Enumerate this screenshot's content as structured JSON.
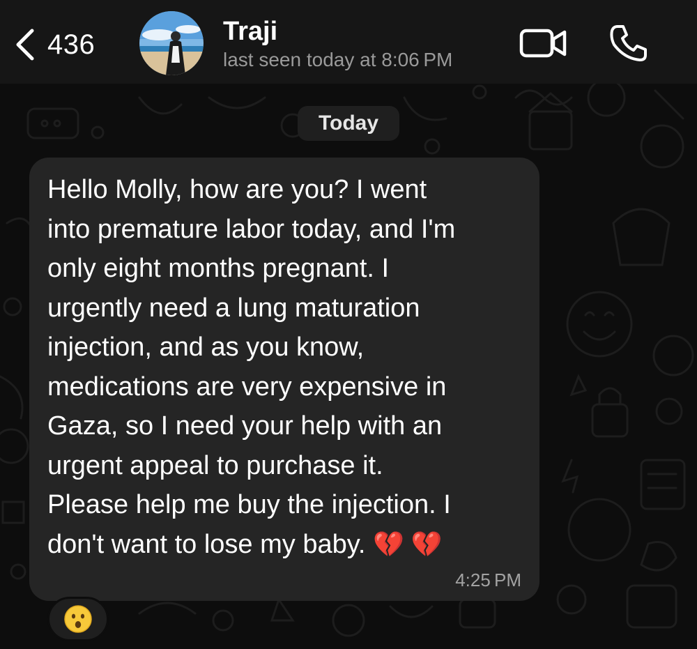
{
  "header": {
    "back_count": "436",
    "contact_name": "Traji",
    "last_seen": "last seen today at 8:06 PM"
  },
  "chat": {
    "date_label": "Today",
    "message": {
      "lines": [
        "Hello Molly, how are you? I went",
        "into premature labor today, and I'm",
        "only eight months pregnant. I",
        "urgently need a lung maturation",
        "injection, and as you know,",
        "medications are very expensive in",
        "Gaza, so I need your help with an",
        "urgent appeal to purchase it.",
        "Please help me buy the injection. I",
        "don't want to lose my baby. "
      ],
      "emoji": "💔 💔",
      "time": "4:25 PM"
    },
    "reaction": {
      "icon": "surprised-face-icon",
      "emoji": "😮"
    }
  },
  "colors": {
    "header_bg": "#161616",
    "chat_bg": "#0d0d0d",
    "bubble_bg": "#252525",
    "secondary_text": "#9a9a9a",
    "heart": "#d0202e"
  }
}
